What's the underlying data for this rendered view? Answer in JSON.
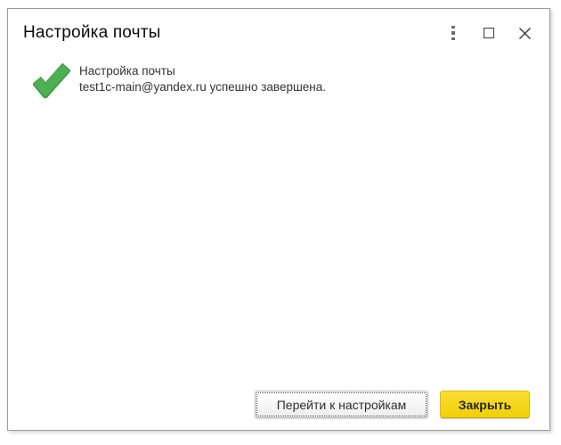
{
  "window": {
    "title": "Настройка почты"
  },
  "titlebar": {
    "icons": [
      {
        "name": "kebab-menu-icon"
      },
      {
        "name": "maximize-icon"
      },
      {
        "name": "close-icon"
      }
    ]
  },
  "message": {
    "icon": "success-check-icon",
    "line1": "Настройка почты",
    "line2": "test1c-main@yandex.ru успешно завершена."
  },
  "footer": {
    "go_to_settings_label": "Перейти к настройкам",
    "close_label": "Закрыть"
  },
  "colors": {
    "accent_yellow": "#f0d008",
    "accent_yellow_light": "#f9dd33",
    "success_green": "#4db052",
    "success_green_dark": "#3f9c46",
    "window_border": "#9c9c9c"
  }
}
